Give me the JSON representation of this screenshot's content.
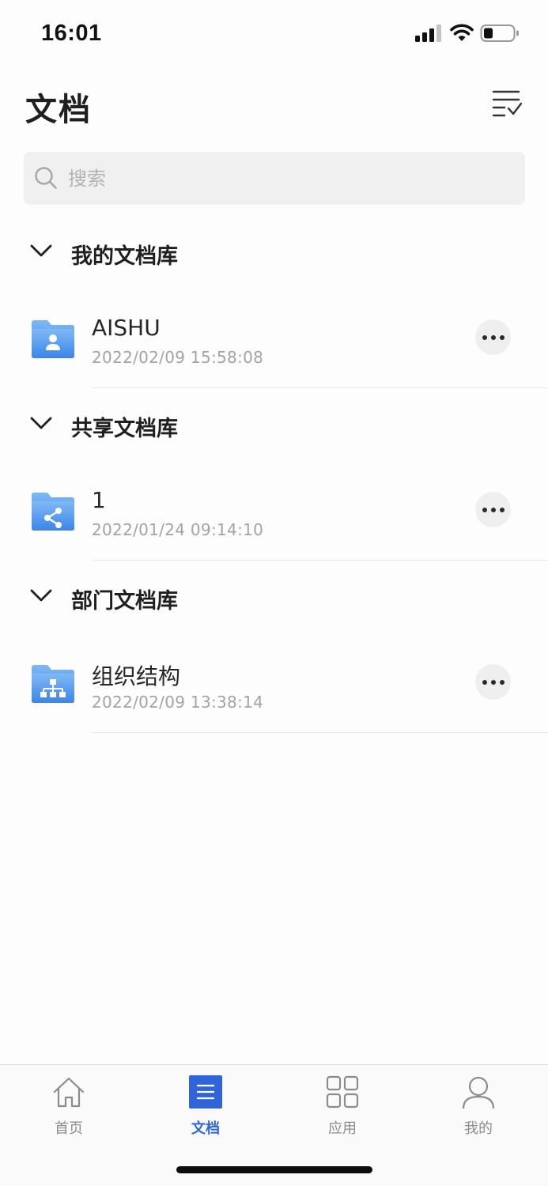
{
  "status_bar": {
    "time": "16:01",
    "icons": [
      "cellular-signal-icon",
      "wifi-icon",
      "battery-icon"
    ]
  },
  "header": {
    "title": "文档",
    "select_icon": "list-check-icon"
  },
  "search": {
    "placeholder": "搜索",
    "value": ""
  },
  "sections": [
    {
      "title": "我的文档库",
      "items": [
        {
          "name": "AISHU",
          "time": "2022/02/09 15:58:08",
          "icon": "personal-folder-icon"
        }
      ]
    },
    {
      "title": "共享文档库",
      "items": [
        {
          "name": "1",
          "time": "2022/01/24 09:14:10",
          "icon": "shared-folder-icon"
        }
      ]
    },
    {
      "title": "部门文档库",
      "items": [
        {
          "name": "组织结构",
          "time": "2022/02/09 13:38:14",
          "icon": "department-folder-icon"
        }
      ]
    }
  ],
  "tab_bar": {
    "tabs": [
      {
        "label": "首页",
        "icon": "home-icon",
        "active": false
      },
      {
        "label": "文档",
        "icon": "document-icon",
        "active": true
      },
      {
        "label": "应用",
        "icon": "apps-grid-icon",
        "active": false
      },
      {
        "label": "我的",
        "icon": "profile-icon",
        "active": false
      }
    ]
  },
  "colors": {
    "accent": "#2f65d9",
    "folder_gradient_top": "#7fb8f5",
    "folder_gradient_bottom": "#3b86ea",
    "background": "#fdfdfd",
    "search_background": "#f0f0f0"
  }
}
